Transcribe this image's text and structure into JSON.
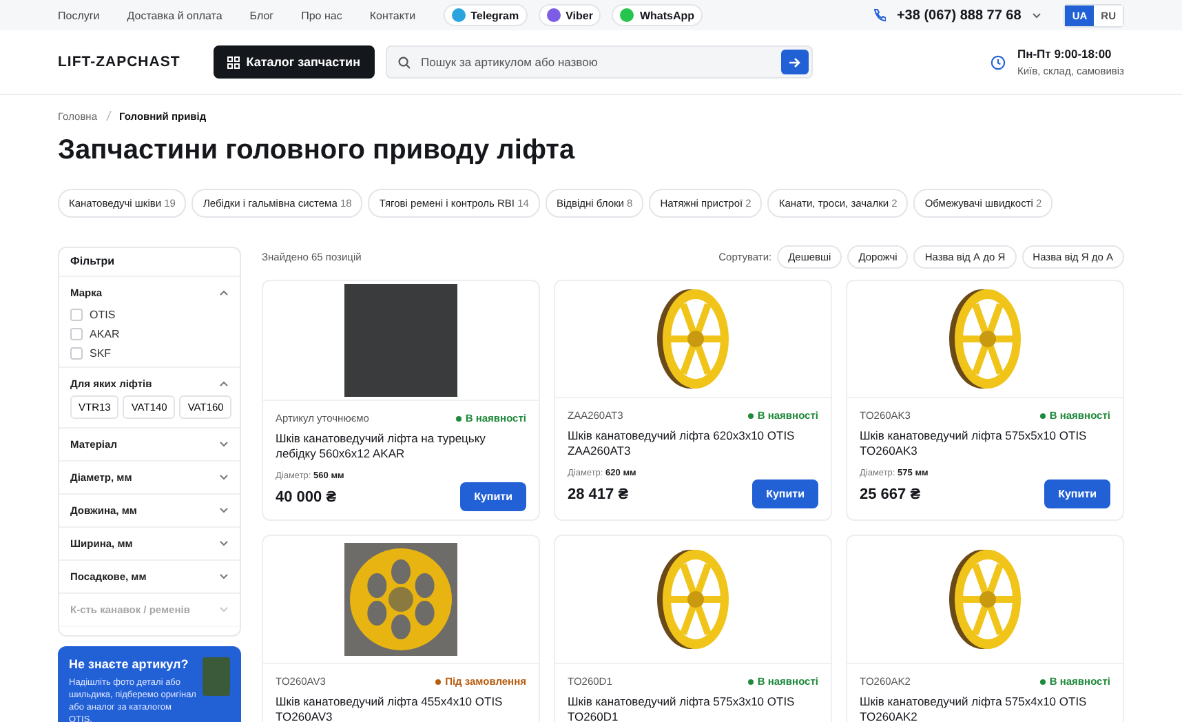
{
  "top_bar": {
    "links": [
      "Послуги",
      "Доставка й оплата",
      "Блог",
      "Про нас",
      "Контакти"
    ],
    "messengers": [
      {
        "label": "Telegram",
        "color": "#2aa3df"
      },
      {
        "label": "Viber",
        "color": "#7d5ce6"
      },
      {
        "label": "WhatsApp",
        "color": "#27c44f"
      }
    ],
    "phone": "+38 (067) 888 77 68",
    "languages": [
      {
        "label": "UA",
        "selected": true
      },
      {
        "label": "RU",
        "selected": false
      }
    ]
  },
  "header": {
    "logo": "LIFT-ZAPCHAST",
    "catalog_button": "Каталог запчастин",
    "search": {
      "placeholder": "Пошук за артикулом або назвою"
    },
    "hours": "Пн-Пт 9:00-18:00",
    "address": "Київ, склад, самовивіз"
  },
  "breadcrumbs": [
    "Головна",
    "Головний привід"
  ],
  "title": "Запчастини головного приводу ліфта",
  "categories": [
    {
      "label": "Канатоведучі шківи",
      "count": "19"
    },
    {
      "label": "Лебідки і гальмівна система",
      "count": "18"
    },
    {
      "label": "Тягові ремені і контроль RBI",
      "count": "14"
    },
    {
      "label": "Відвідні блоки",
      "count": "8"
    },
    {
      "label": "Натяжні пристрої",
      "count": "2"
    },
    {
      "label": "Канати, троси, зачалки",
      "count": "2"
    },
    {
      "label": "Обмежувачі швидкості",
      "count": "2"
    }
  ],
  "filters": {
    "title": "Фільтри",
    "sections": [
      {
        "title": "Марка",
        "expanded": true,
        "kind": "checkboxes",
        "options": [
          {
            "label": "OTIS",
            "checked": false
          },
          {
            "label": "AKAR",
            "checked": false
          },
          {
            "label": "SKF",
            "checked": false
          }
        ]
      },
      {
        "title": "Для яких ліфтів",
        "expanded": true,
        "kind": "tags",
        "options": [
          {
            "label": "VTR13"
          },
          {
            "label": "VAT140"
          },
          {
            "label": "VAT160"
          }
        ]
      },
      {
        "title": "Матеріал",
        "expanded": false
      },
      {
        "title": "Діаметр, мм",
        "expanded": false
      },
      {
        "title": "Довжина, мм",
        "expanded": false
      },
      {
        "title": "Ширина, мм",
        "expanded": false
      },
      {
        "title": "Посадкове, мм",
        "expanded": false
      },
      {
        "title": "К-сть канавок / ременів",
        "expanded": false,
        "faded": true
      }
    ]
  },
  "promo": {
    "title": "Не знаєте артикул?",
    "text": "Надішліть фото деталі або шильдика, підберемо оригінал або аналог за каталогом OTIS."
  },
  "results": {
    "count": "Знайдено 65 позицій",
    "sort_label": "Сортувати:",
    "sort_options": [
      "Дешевші",
      "Дорожчі",
      "Назва від А до Я",
      "Назва від Я до А"
    ]
  },
  "products": [
    {
      "kind": "photo",
      "sku": "Артикул уточнюємо",
      "status": "В наявності",
      "in_stock": true,
      "name": "Шків канатоведучий ліфта на турецьку лебідку 560x6x12 AKAR",
      "spec_label": "Діаметр:",
      "spec_value": "560 мм",
      "price": "40 000 ₴",
      "buy": "Купити"
    },
    {
      "kind": "render",
      "sku": "ZAA260AT3",
      "status": "В наявності",
      "in_stock": true,
      "name": "Шків канатоведучий ліфта 620x3x10 OTIS ZAA260AT3",
      "spec_label": "Діаметр:",
      "spec_value": "620 мм",
      "price": "28 417 ₴",
      "buy": "Купити"
    },
    {
      "kind": "render",
      "sku": "TO260AK3",
      "status": "В наявності",
      "in_stock": true,
      "name": "Шків канатоведучий ліфта 575x5x10 OTIS TO260AK3",
      "spec_label": "Діаметр:",
      "spec_value": "575 мм",
      "price": "25 667 ₴",
      "buy": "Купити"
    },
    {
      "kind": "snapshot",
      "sku": "TO260AV3",
      "status": "Під замовлення",
      "in_stock": false,
      "name": "Шків канатоведучий ліфта 455x4x10 OTIS TO260AV3"
    },
    {
      "kind": "render",
      "sku": "TO260D1",
      "status": "В наявності",
      "in_stock": true,
      "name": "Шків канатоведучий ліфта 575x3x10 OTIS TO260D1"
    },
    {
      "kind": "render",
      "sku": "TO260AK2",
      "status": "В наявності",
      "in_stock": true,
      "name": "Шків канатоведучий ліфта 575x4x10 OTIS TO260AK2"
    }
  ]
}
